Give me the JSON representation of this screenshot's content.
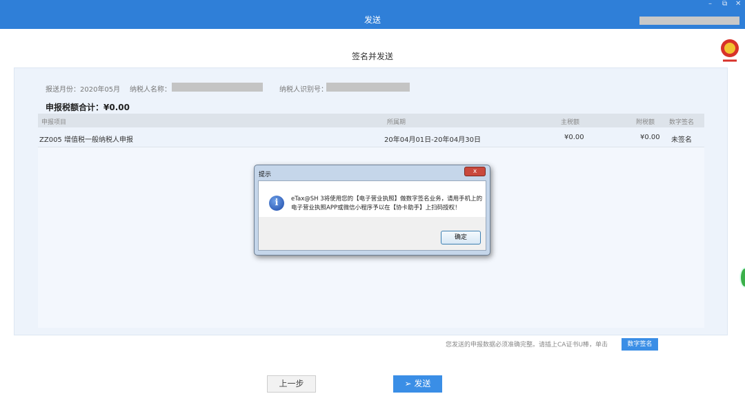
{
  "window": {
    "title": "发送",
    "controls": [
      "–",
      "⧉",
      "✕"
    ]
  },
  "heading": "签名并发送",
  "info": {
    "month_label": "报送月份：2020年05月",
    "name_label": "纳税人名称：",
    "id_label": "纳税人识别号："
  },
  "total": "申报税额合计：¥0.00",
  "table": {
    "headers": [
      "申报项目",
      "所属期",
      "主税额",
      "附税额",
      "数字签名"
    ],
    "rows": [
      [
        "ZZ005 增值税一般纳税人申报",
        "20年04月01日-20年04月30日",
        "¥0.00",
        "¥0.00",
        "未签名"
      ]
    ]
  },
  "dialog": {
    "title": "提示",
    "message": "eTax@SH 3将使用您的【电子营业执照】做数字签名业务，请用手机上的电子营业执照APP或微信小程序予以在【协卡助手】上扫码授权！",
    "ok": "确定",
    "close": "x"
  },
  "footer": {
    "note": "您发送的申报数据必须准确完整。请插上CA证书U棒，单击",
    "sign_button": "数字签名",
    "prev_button": "上一步",
    "send_button": "发送"
  }
}
